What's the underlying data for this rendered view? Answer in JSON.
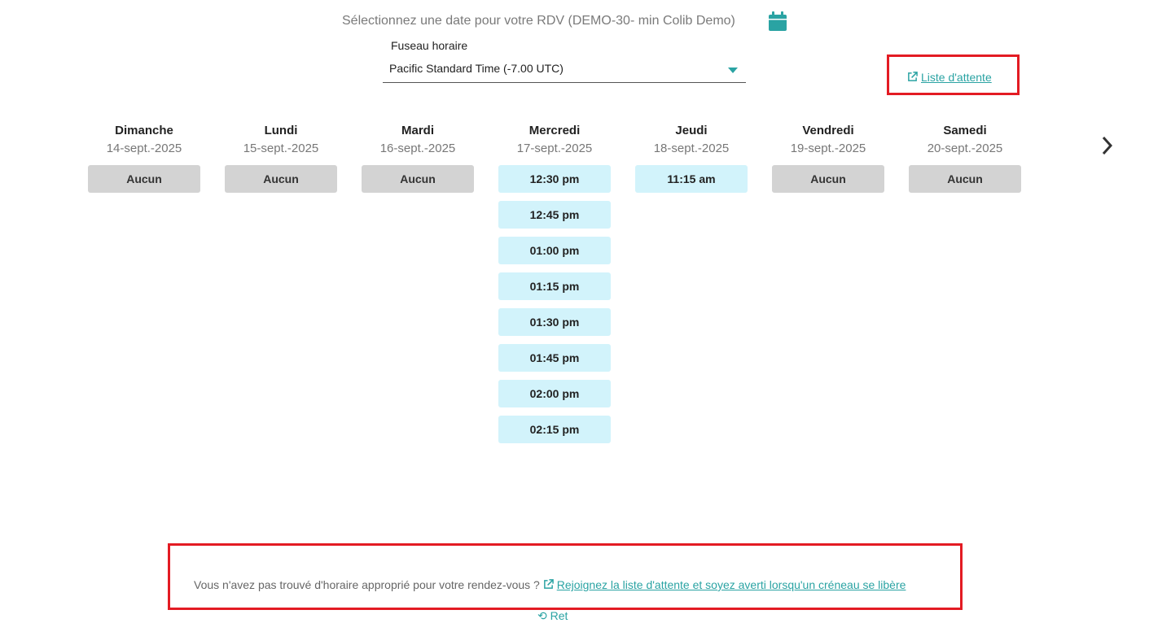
{
  "header": {
    "title": "Sélectionnez une date pour votre RDV (DEMO-30- min Colib Demo)",
    "calendar_icon": "calendar-icon"
  },
  "timezone": {
    "label": "Fuseau horaire",
    "value": "Pacific Standard Time (-7.00 UTC)"
  },
  "waitlist": {
    "top_link": "Liste d'attente",
    "bottom_text": "Vous n'avez pas trouvé d'horaire approprié pour votre rendez-vous ?",
    "bottom_link": "Rejoignez la liste d'attente et soyez averti lorsqu'un créneau se libère"
  },
  "days": [
    {
      "name": "Dimanche",
      "date": "14-sept.-2025",
      "slots": [],
      "empty_label": "Aucun"
    },
    {
      "name": "Lundi",
      "date": "15-sept.-2025",
      "slots": [],
      "empty_label": "Aucun"
    },
    {
      "name": "Mardi",
      "date": "16-sept.-2025",
      "slots": [],
      "empty_label": "Aucun"
    },
    {
      "name": "Mercredi",
      "date": "17-sept.-2025",
      "slots": [
        "12:30 pm",
        "12:45 pm",
        "01:00 pm",
        "01:15 pm",
        "01:30 pm",
        "01:45 pm",
        "02:00 pm",
        "02:15 pm"
      ]
    },
    {
      "name": "Jeudi",
      "date": "18-sept.-2025",
      "slots": [
        "11:15 am"
      ]
    },
    {
      "name": "Vendredi",
      "date": "19-sept.-2025",
      "slots": [],
      "empty_label": "Aucun"
    },
    {
      "name": "Samedi",
      "date": "20-sept.-2025",
      "slots": [],
      "empty_label": "Aucun"
    }
  ],
  "footer": {
    "back_label": "Ret"
  },
  "colors": {
    "accent": "#2aa3a3",
    "slot_available": "#d2f3fb",
    "slot_none": "#d3d3d3",
    "highlight_border": "#e31b23"
  }
}
